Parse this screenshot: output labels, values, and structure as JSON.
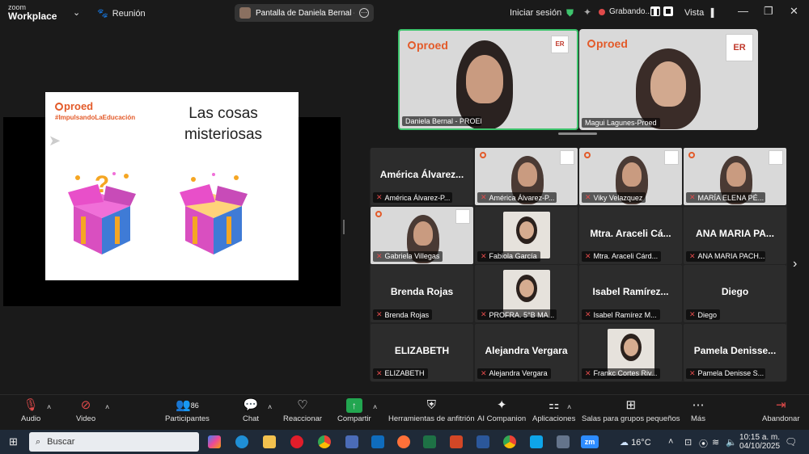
{
  "titlebar": {
    "brand_line1": "zoom",
    "brand_line2": "Workplace",
    "meeting_label": "Reunión",
    "share_label": "Pantalla de Daniela Bernal - PROED",
    "signin": "Iniciar sesión",
    "recording": "Grabando...",
    "view": "Vista"
  },
  "slide": {
    "logo": "proed",
    "hashtag": "#ImpulsandoLaEducación",
    "title_line1": "Las cosas",
    "title_line2": "misteriosas"
  },
  "speakers": [
    {
      "name": "Daniela Bernal - PROED"
    },
    {
      "name": "Magui Lagunes-Proed"
    }
  ],
  "gallery": [
    {
      "big": "América Álvarez...",
      "name": "América Álvarez-P...",
      "type": "name"
    },
    {
      "big": "",
      "name": "América Álvarez-P...",
      "type": "cam"
    },
    {
      "big": "",
      "name": "Viky Velazquez",
      "type": "cam"
    },
    {
      "big": "",
      "name": "MARÍA ELENA PÉ...",
      "type": "cam"
    },
    {
      "big": "",
      "name": "Gabriela Villegas",
      "type": "cam"
    },
    {
      "big": "",
      "name": "Fabiola García",
      "type": "photo"
    },
    {
      "big": "Mtra. Araceli Cá...",
      "name": "Mtra. Araceli Cárd...",
      "type": "name"
    },
    {
      "big": "ANA MARIA PA...",
      "name": "ANA MARIA PACH...",
      "type": "name"
    },
    {
      "big": "Brenda Rojas",
      "name": "Brenda Rojas",
      "type": "name"
    },
    {
      "big": "",
      "name": "PROFRA. 5°B MA...",
      "type": "photo"
    },
    {
      "big": "Isabel Ramírez...",
      "name": "Isabel Ramírez M...",
      "type": "name"
    },
    {
      "big": "Diego",
      "name": "Diego",
      "type": "name"
    },
    {
      "big": "ELIZABETH",
      "name": "ELIZABETH",
      "type": "name"
    },
    {
      "big": "Alejandra Vergara",
      "name": "Alejandra Vergara",
      "type": "name"
    },
    {
      "big": "",
      "name": "Frankc Cortes Riv...",
      "type": "photo"
    },
    {
      "big": "Pamela Denisse...",
      "name": "Pamela Denisse S...",
      "type": "name"
    }
  ],
  "toolbar": {
    "audio": "Audio",
    "video": "Video",
    "participants": "Participantes",
    "participants_count": "86",
    "chat": "Chat",
    "react": "Reaccionar",
    "share": "Compartir",
    "host_tools": "Herramientas de anfitrión",
    "ai": "AI Companion",
    "apps": "Aplicaciones",
    "breakout": "Salas para grupos pequeños",
    "more": "Más",
    "leave": "Abandonar"
  },
  "taskbar": {
    "search": "Buscar",
    "temp": "16°C",
    "time": "10:15 a. m.",
    "date": "04/10/2025"
  }
}
